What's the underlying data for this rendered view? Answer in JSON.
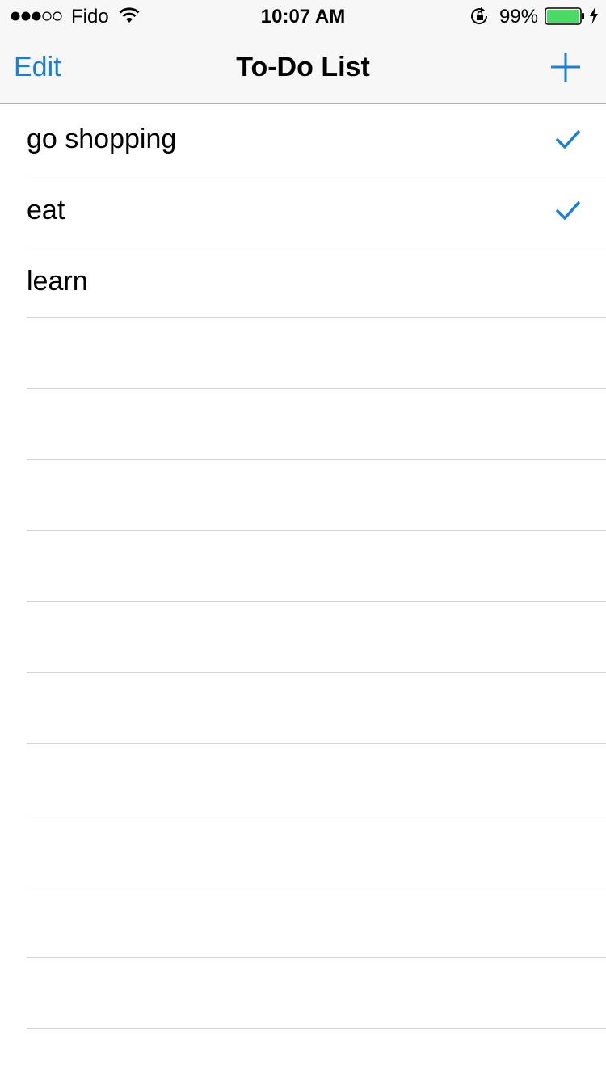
{
  "status_bar": {
    "carrier": "Fido",
    "time": "10:07 AM",
    "battery_percent": "99%",
    "signal_bars": 3,
    "signal_total": 5,
    "battery_level": 0.99,
    "battery_color": "#4cd964",
    "icons": [
      "signal-dots",
      "wifi-icon",
      "rotation-lock-icon",
      "battery-icon",
      "charging-bolt-icon"
    ]
  },
  "nav": {
    "edit_label": "Edit",
    "title": "To-Do List",
    "add_icon": "plus-icon",
    "accent_color": "#1a7fdc"
  },
  "todos": [
    {
      "label": "go shopping",
      "checked": true
    },
    {
      "label": "eat",
      "checked": true
    },
    {
      "label": "learn",
      "checked": false
    }
  ],
  "empty_rows": 10
}
